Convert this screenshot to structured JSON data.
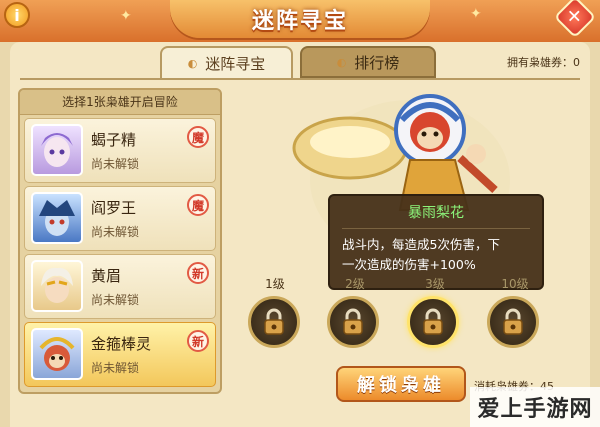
{
  "header": {
    "title": "迷阵寻宝",
    "info_glyph": "i",
    "close_glyph": "✕"
  },
  "tabs": [
    {
      "label": "迷阵寻宝",
      "active": true
    },
    {
      "label": "排行榜",
      "active": false
    }
  ],
  "tickets": {
    "label": "拥有枭雄券：0"
  },
  "hero_list": {
    "header": "选择1张枭雄开启冒险",
    "items": [
      {
        "name": "蝎子精",
        "status": "尚未解锁",
        "badge": "魔"
      },
      {
        "name": "阎罗王",
        "status": "尚未解锁",
        "badge": "魔"
      },
      {
        "name": "黄眉",
        "status": "尚未解锁",
        "badge": "新"
      },
      {
        "name": "金箍棒灵",
        "status": "尚未解锁",
        "badge": "新"
      }
    ]
  },
  "tooltip": {
    "title": "暴雨梨花",
    "line1": "战斗内，每造成5次伤害，下",
    "line2": "一次造成的伤害+100%"
  },
  "levels": [
    {
      "label": "1级"
    },
    {
      "label": "2级"
    },
    {
      "label": "3级"
    },
    {
      "label": "10级"
    }
  ],
  "unlock": {
    "button": "解锁枭雄",
    "cost": "消耗枭雄券：45"
  },
  "watermark": "爱上手游网",
  "colors": {
    "accent": "#e38a35",
    "tooltip_title": "#8cf57a",
    "badge_red": "#d23a2a"
  }
}
